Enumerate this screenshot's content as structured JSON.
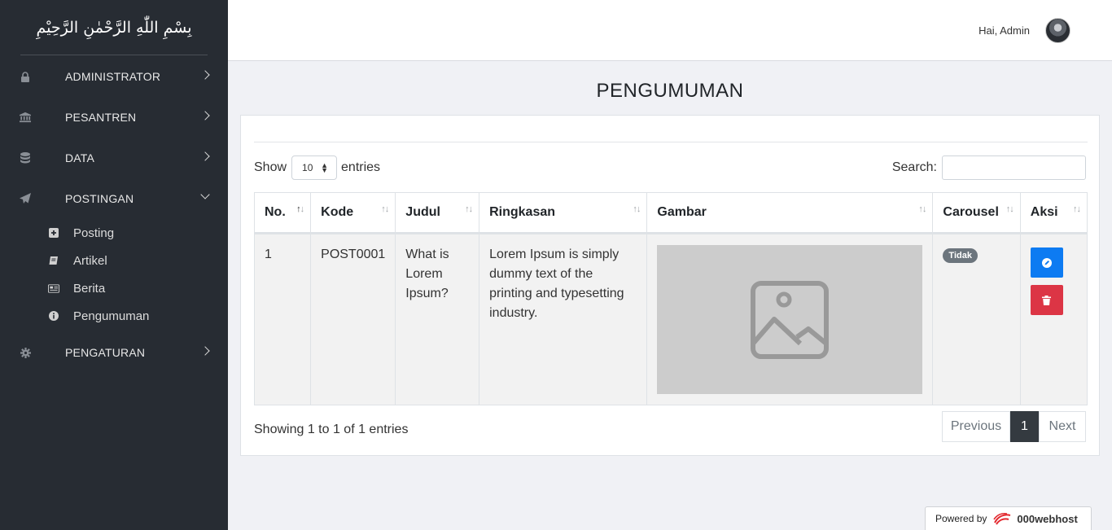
{
  "sidebar": {
    "brand": "بِسْمِ اللّٰهِ الرَّحْمٰنِ الرَّحِيْمِ",
    "items": [
      {
        "label": "ADMINISTRATOR",
        "icon": "user-lock-icon"
      },
      {
        "label": "PESANTREN",
        "icon": "landmark-icon"
      },
      {
        "label": "DATA",
        "icon": "database-icon"
      },
      {
        "label": "POSTINGAN",
        "icon": "paper-plane-icon"
      },
      {
        "label": "PENGATURAN",
        "icon": "gear-icon"
      }
    ],
    "submenu": [
      {
        "label": "Posting",
        "icon": "plus-square-icon"
      },
      {
        "label": "Artikel",
        "icon": "book-icon"
      },
      {
        "label": "Berita",
        "icon": "newspaper-icon"
      },
      {
        "label": "Pengumuman",
        "icon": "info-circle-icon"
      }
    ]
  },
  "header": {
    "greeting": "Hai, Admin"
  },
  "main": {
    "title": "PENGUMUMAN",
    "show_label": "Show",
    "show_value": "10",
    "entries_label": "entries",
    "search_label": "Search:",
    "search_value": "",
    "columns": [
      "No.",
      "Kode",
      "Judul",
      "Ringkasan",
      "Gambar",
      "Carousel",
      "Aksi"
    ],
    "rows": [
      {
        "no": "1",
        "kode": "POST0001",
        "judul": "What is Lorem Ipsum?",
        "ringkasan": "Lorem Ipsum is simply dummy text of the printing and typesetting industry.",
        "gambar": "image-placeholder-icon",
        "carousel": "Tidak"
      }
    ],
    "info": "Showing 1 to 1 of 1 entries",
    "pagination": {
      "previous": "Previous",
      "current": "1",
      "next": "Next"
    }
  },
  "footer": {
    "powered_by": "Powered by",
    "host": "000webhost"
  },
  "colors": {
    "sidebar_bg": "#272c33",
    "edit_button": "#0d7bf2",
    "delete_button": "#dc3545",
    "badge": "#6c757d",
    "active_page": "#343a40"
  }
}
